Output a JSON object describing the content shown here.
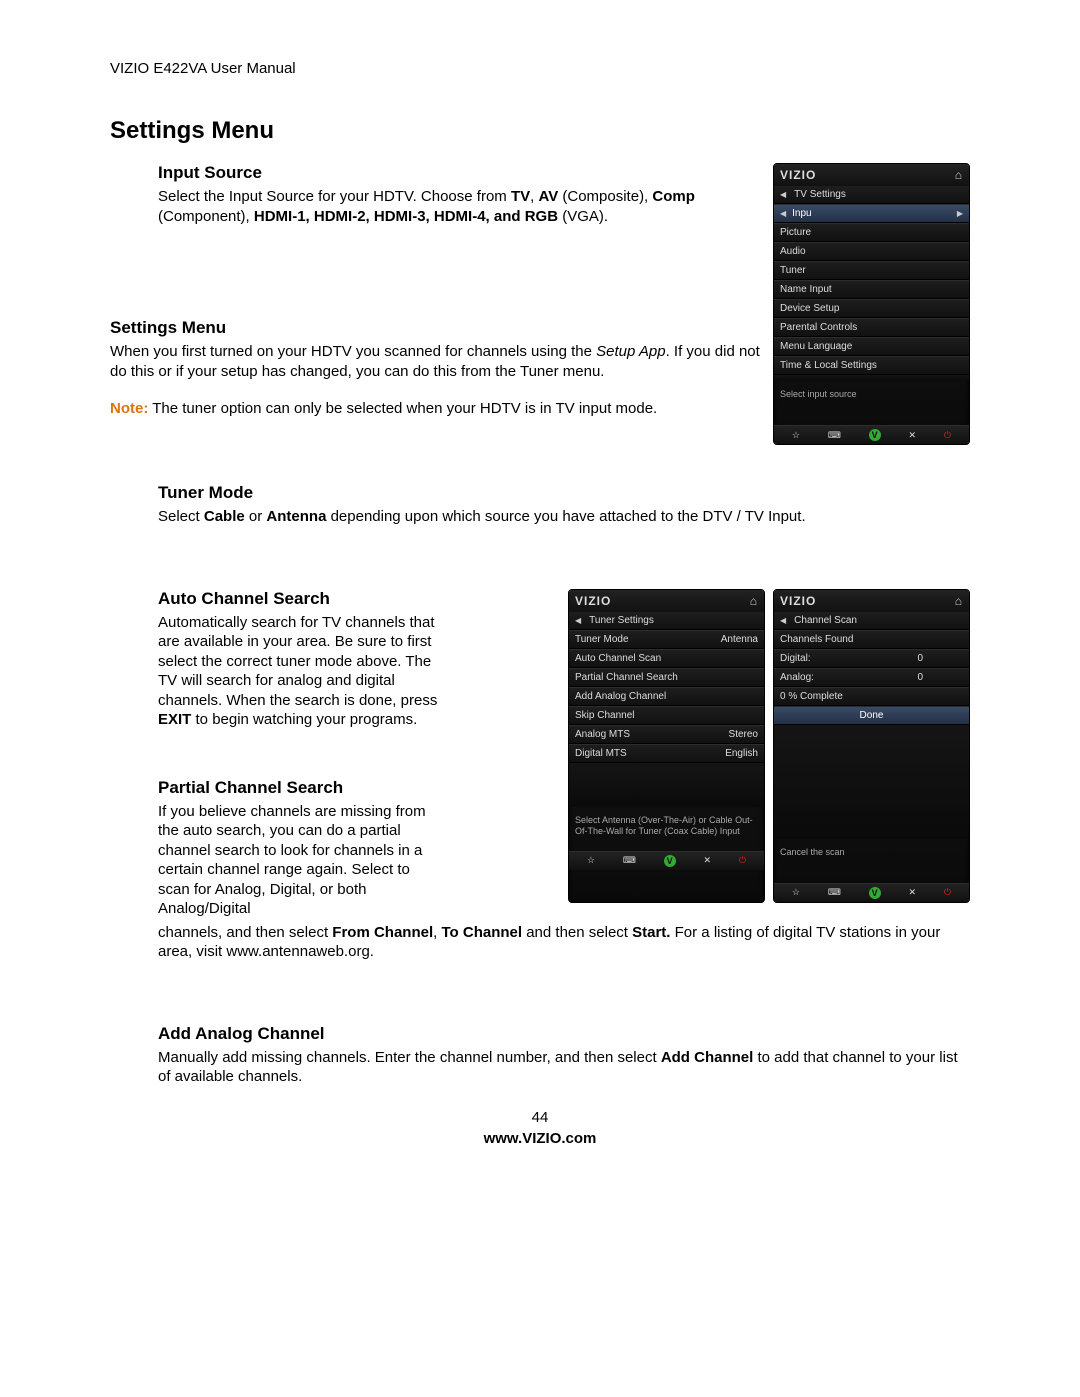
{
  "header": "VIZIO E422VA User Manual",
  "h1": "Settings Menu",
  "input_source": {
    "h": "Input Source",
    "p1a": "Select the Input Source for your HDTV. Choose from ",
    "b1": "TV",
    "c1": ", ",
    "b2": "AV",
    "p1b": " (Composite), ",
    "b3": "Comp",
    "p1c": " (Component), ",
    "b4": "HDMI-1, HDMI-2, HDMI-3, HDMI-4, and RGB",
    "p1d": " (VGA)."
  },
  "settings_menu": {
    "h": "Settings Menu",
    "p1a": "When you first turned on your HDTV you scanned for channels using the ",
    "i1": "Setup App",
    "p1b": ". If you did not do this or if your setup has changed, you can do this from the Tuner menu.",
    "note_label": "Note:",
    "note_text": " The tuner option can only be selected when your HDTV is in TV input mode."
  },
  "tuner_mode": {
    "h": "Tuner Mode",
    "p1a": "Select ",
    "b1": "Cable",
    "p1b": " or ",
    "b2": "Antenna",
    "p1c": " depending upon which source you have attached to the DTV / TV Input."
  },
  "auto_search": {
    "h": "Auto Channel Search",
    "p1a": "Automatically search for TV channels that are available in your area. Be sure to first select the correct tuner mode above. The TV will search for analog and digital channels. When the search is done, press ",
    "b1": "EXIT",
    "p1b": " to begin watching your programs."
  },
  "partial_search": {
    "h": "Partial Channel Search",
    "p1": "If you believe channels are missing from the auto search, you can do a partial channel search to look for channels in a certain channel range again. Select to scan for Analog, Digital, or both Analog/Digital",
    "p2a": "channels, and then select ",
    "b1": "From Channel",
    "c1": ", ",
    "b2": "To Channel",
    "p2b": " and then select ",
    "b3": "Start.",
    "p2c": " For a listing of digital TV stations in your area, visit www.antennaweb.org."
  },
  "add_analog": {
    "h": "Add Analog Channel",
    "p1a": "Manually add missing channels. Enter the channel number, and then select ",
    "b1": "Add Channel",
    "p1b": " to add that channel to your list of available channels."
  },
  "footer": {
    "page": "44",
    "url": "www.VIZIO.com"
  },
  "tv1": {
    "brand": "VIZIO",
    "sub": "TV Settings",
    "rows": [
      "Inpu",
      "Picture",
      "Audio",
      "Tuner",
      "Name Input",
      "Device Setup",
      "Parental Controls",
      "Menu Language",
      "Time & Local Settings"
    ],
    "hint": "Select input source"
  },
  "tv2": {
    "brand": "VIZIO",
    "sub": "Tuner Settings",
    "rows": [
      {
        "l": "Tuner Mode",
        "r": "Antenna"
      },
      {
        "l": "Auto Channel Scan",
        "r": ""
      },
      {
        "l": "Partial Channel Search",
        "r": ""
      },
      {
        "l": "Add Analog Channel",
        "r": ""
      },
      {
        "l": "Skip Channel",
        "r": ""
      },
      {
        "l": "Analog MTS",
        "r": "Stereo"
      },
      {
        "l": "Digital MTS",
        "r": "English"
      }
    ],
    "hint": "Select Antenna (Over-The-Air) or Cable Out-Of-The-Wall for Tuner (Coax Cable) Input"
  },
  "tv3": {
    "brand": "VIZIO",
    "sub": "Channel Scan",
    "rows": [
      {
        "l": "Channels Found",
        "r": ""
      },
      {
        "l": "Digital:",
        "r": "0"
      },
      {
        "l": "Analog:",
        "r": "0"
      },
      {
        "l": "0 % Complete",
        "r": ""
      }
    ],
    "done": "Done",
    "hint": "Cancel the scan"
  }
}
